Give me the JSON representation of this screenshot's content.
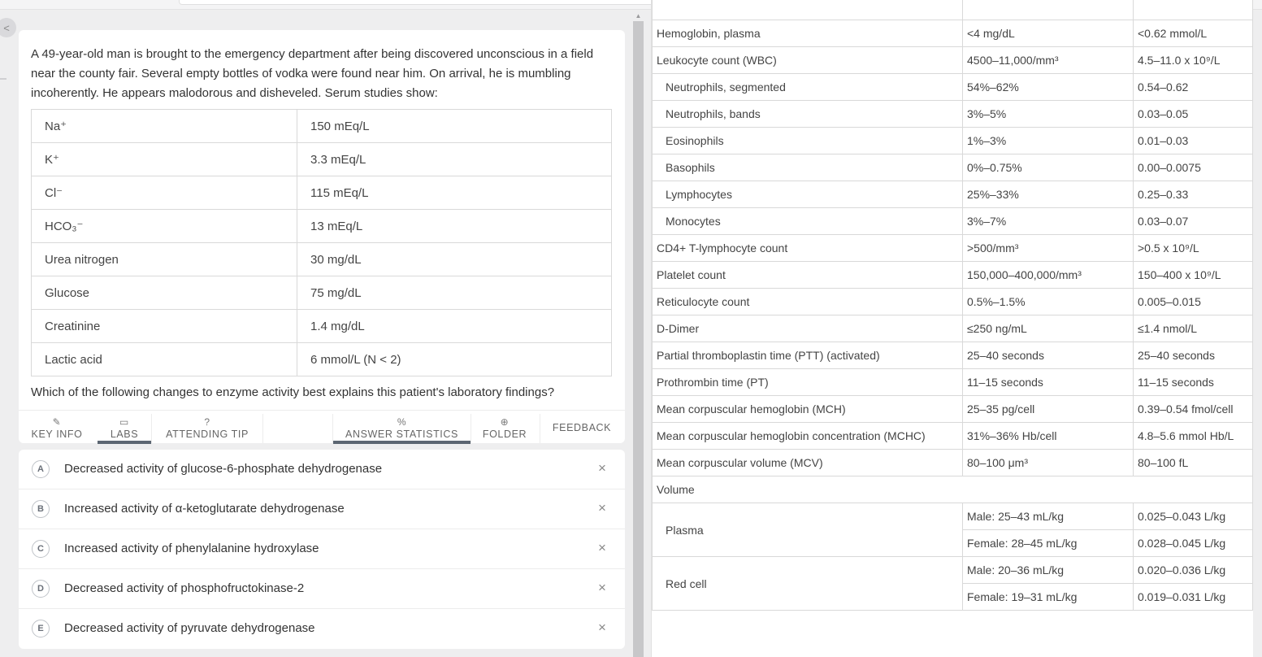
{
  "question": {
    "stem": "A 49-year-old man is brought to the emergency department after being discovered unconscious in a field near the county fair. Several empty bottles of vodka were found near him. On arrival, he is mumbling incoherently. He appears malodorous and disheveled. Serum studies show:",
    "labs": [
      {
        "name": "Na⁺",
        "value": "150 mEq/L"
      },
      {
        "name": "K⁺",
        "value": "3.3 mEq/L"
      },
      {
        "name": "Cl⁻",
        "value": "115 mEq/L"
      },
      {
        "name": "HCO₃⁻",
        "value": "13 mEq/L"
      },
      {
        "name": "Urea nitrogen",
        "value": "30 mg/dL"
      },
      {
        "name": "Glucose",
        "value": "75 mg/dL"
      },
      {
        "name": "Creatinine",
        "value": "1.4 mg/dL"
      },
      {
        "name": "Lactic acid",
        "value": "6 mmol/L (N < 2)"
      }
    ],
    "prompt": "Which of the following changes to enzyme activity best explains this patient's laboratory findings?"
  },
  "toolbar": {
    "key_info": "KEY INFO",
    "labs": "LABS",
    "attending_tip": "ATTENDING TIP",
    "answer_statistics": "ANSWER STATISTICS",
    "folder": "FOLDER",
    "feedback": "FEEDBACK",
    "active_tabs": [
      "labs",
      "answer_statistics"
    ]
  },
  "answers": [
    {
      "letter": "A",
      "text": "Decreased activity of glucose-6-phosphate dehydrogenase"
    },
    {
      "letter": "B",
      "text": "Increased activity of α-ketoglutarate dehydrogenase"
    },
    {
      "letter": "C",
      "text": "Increased activity of phenylalanine hydroxylase"
    },
    {
      "letter": "D",
      "text": "Decreased activity of phosphofructokinase-2"
    },
    {
      "letter": "E",
      "text": "Decreased activity of pyruvate dehydrogenase"
    }
  ],
  "strike_symbol": "×",
  "collapse_symbol": "<",
  "reference": {
    "rows": [
      {
        "name": "Hemoglobin, plasma",
        "conventional": "<4 mg/dL",
        "si": "<0.62 mmol/L"
      },
      {
        "name": "Leukocyte count (WBC)",
        "conventional": "4500–11,000/mm³",
        "si": "4.5–11.0 x 10⁹/L"
      },
      {
        "name": "Neutrophils, segmented",
        "conventional": "54%–62%",
        "si": "0.54–0.62",
        "indent": true
      },
      {
        "name": "Neutrophils, bands",
        "conventional": "3%–5%",
        "si": "0.03–0.05",
        "indent": true
      },
      {
        "name": "Eosinophils",
        "conventional": "1%–3%",
        "si": "0.01–0.03",
        "indent": true
      },
      {
        "name": "Basophils",
        "conventional": "0%–0.75%",
        "si": "0.00–0.0075",
        "indent": true
      },
      {
        "name": "Lymphocytes",
        "conventional": "25%–33%",
        "si": "0.25–0.33",
        "indent": true
      },
      {
        "name": "Monocytes",
        "conventional": "3%–7%",
        "si": "0.03–0.07",
        "indent": true
      },
      {
        "name": "CD4+ T-lymphocyte count",
        "conventional": ">500/mm³",
        "si": ">0.5 x 10⁹/L"
      },
      {
        "name": "Platelet count",
        "conventional": "150,000–400,000/mm³",
        "si": "150–400 x 10⁹/L"
      },
      {
        "name": "Reticulocyte count",
        "conventional": "0.5%–1.5%",
        "si": "0.005–0.015"
      },
      {
        "name": "D-Dimer",
        "conventional": "≤250 ng/mL",
        "si": "≤1.4 nmol/L"
      },
      {
        "name": "Partial thromboplastin time (PTT) (activated)",
        "conventional": "25–40 seconds",
        "si": "25–40 seconds"
      },
      {
        "name": "Prothrombin time (PT)",
        "conventional": "11–15 seconds",
        "si": "11–15 seconds"
      },
      {
        "name": "Mean corpuscular hemoglobin (MCH)",
        "conventional": "25–35 pg/cell",
        "si": "0.39–0.54 fmol/cell"
      },
      {
        "name": "Mean corpuscular hemoglobin concentration (MCHC)",
        "conventional": "31%–36% Hb/cell",
        "si": "4.8–5.6 mmol Hb/L"
      },
      {
        "name": "Mean corpuscular volume (MCV)",
        "conventional": "80–100 μm³",
        "si": "80–100 fL"
      }
    ],
    "volume_header": "Volume",
    "plasma": {
      "label": "Plasma",
      "male": "Male: 25–43 mL/kg",
      "male_si": "0.025–0.043 L/kg",
      "female": "Female: 28–45 mL/kg",
      "female_si": "0.028–0.045 L/kg"
    },
    "red_cell": {
      "label": "Red cell",
      "male": "Male: 20–36 mL/kg",
      "male_si": "0.020–0.036 L/kg",
      "female": "Female: 19–31 mL/kg",
      "female_si": "0.019–0.031 L/kg"
    }
  }
}
